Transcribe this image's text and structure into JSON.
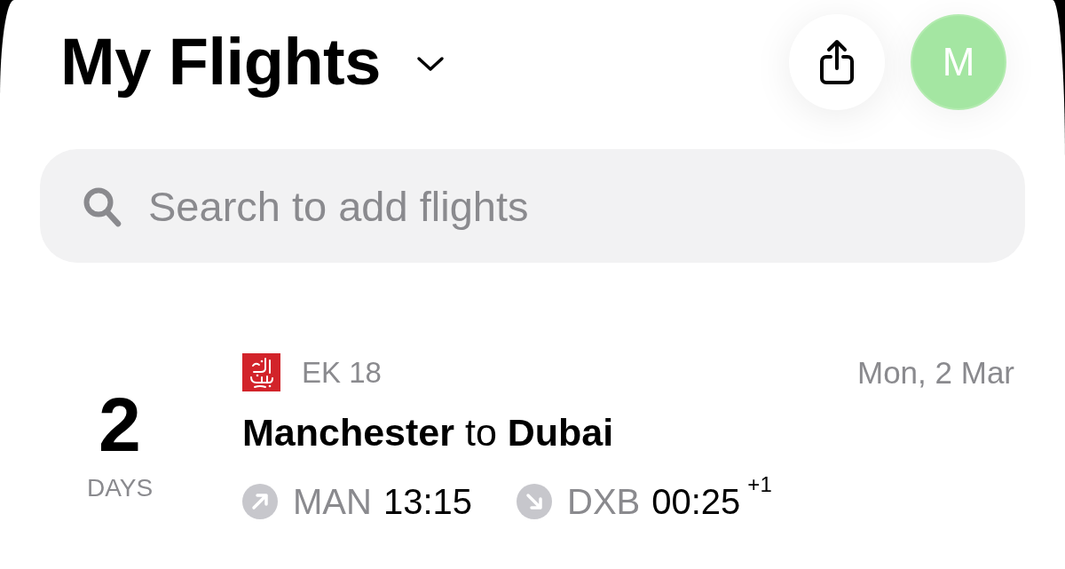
{
  "header": {
    "title": "My Flights",
    "avatar": {
      "initial": "M"
    }
  },
  "search": {
    "placeholder": "Search to add flights"
  },
  "flights": [
    {
      "countdown": "2",
      "countdown_unit": "DAYS",
      "flight_number": "EK 18",
      "date": "Mon, 2 Mar",
      "route": "**Manchester** to **Dubai**",
      "times": [
        {
          "kind": "departure",
          "airport": "MAN",
          "time": "13:15"
        },
        {
          "kind": "arrival",
          "airport": "DXB",
          "time": "00:25",
          "day_offset": "+1"
        }
      ]
    }
  ]
}
